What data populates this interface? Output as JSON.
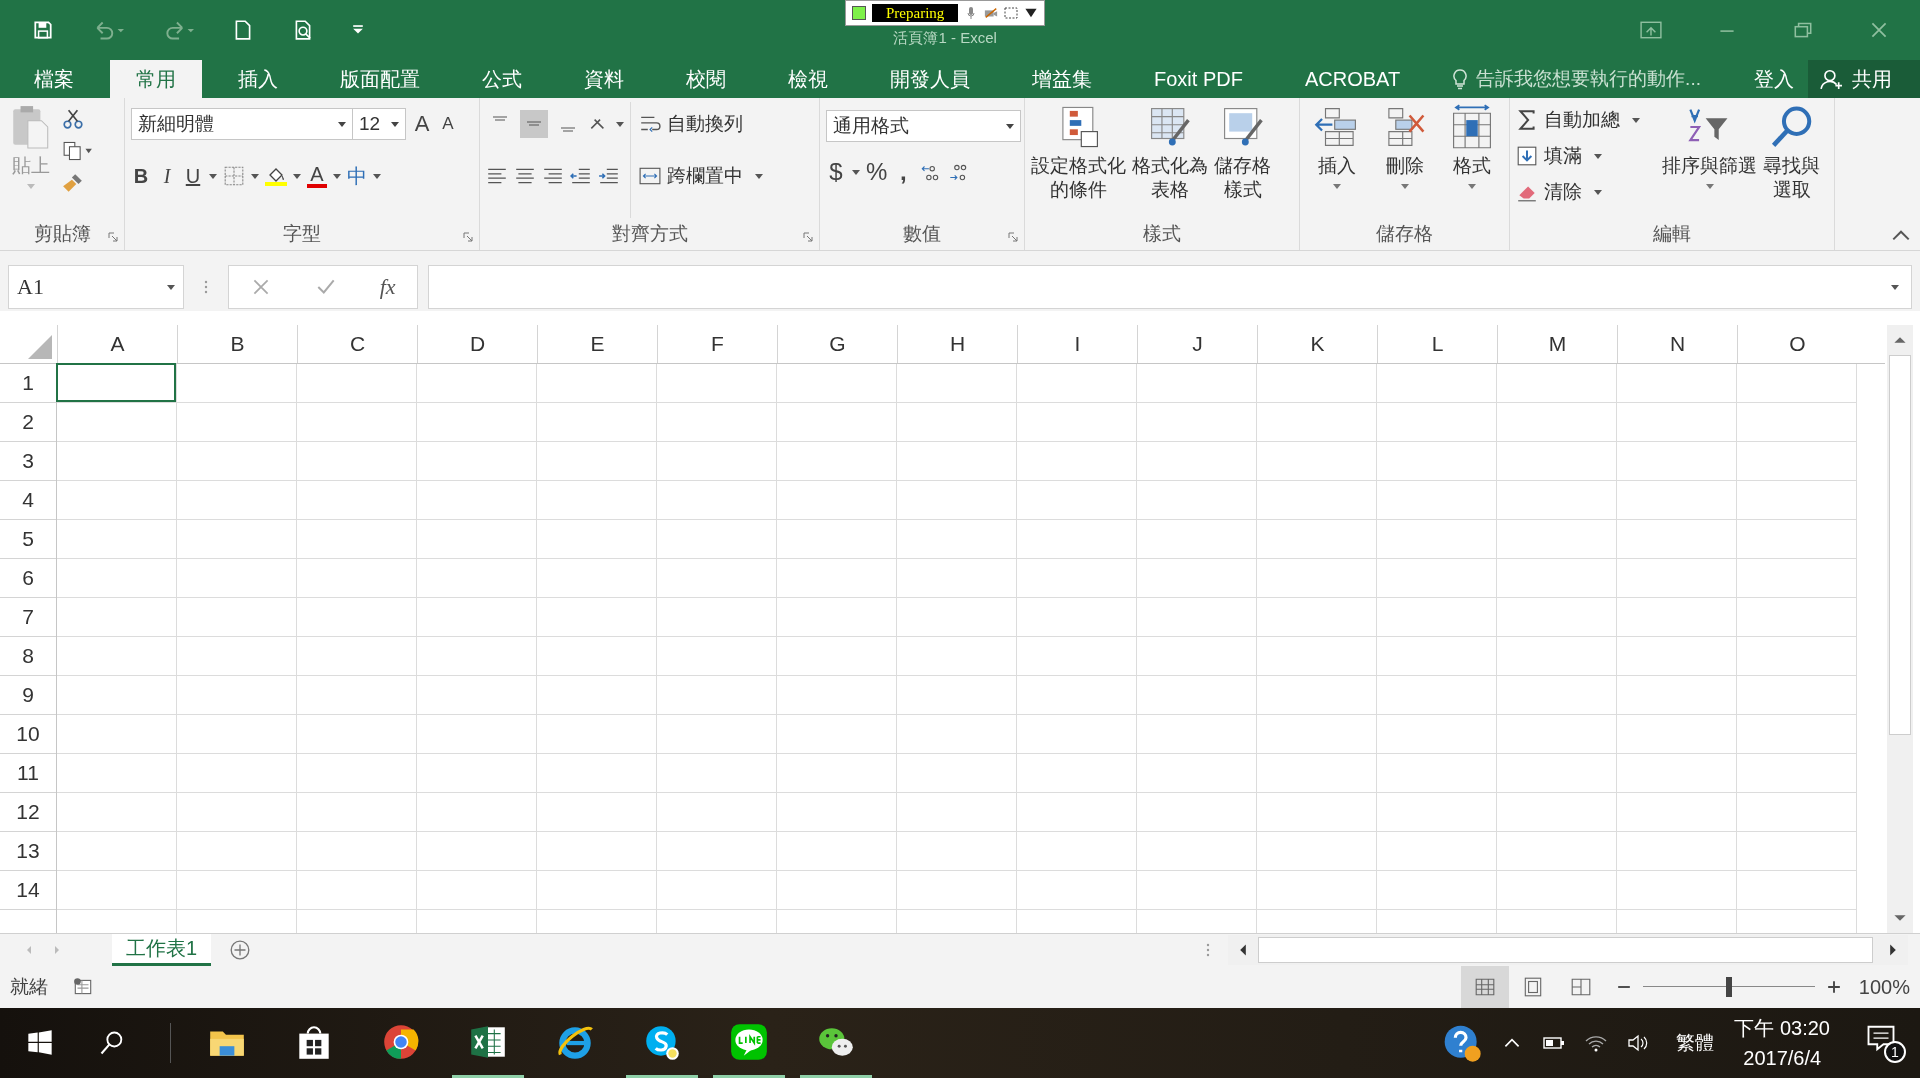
{
  "window": {
    "title": "活頁簿1 - Excel",
    "recorder": "Preparing"
  },
  "tabs": [
    {
      "label": "檔案",
      "selected": false
    },
    {
      "label": "常用",
      "selected": true
    },
    {
      "label": "插入",
      "selected": false
    },
    {
      "label": "版面配置",
      "selected": false
    },
    {
      "label": "公式",
      "selected": false
    },
    {
      "label": "資料",
      "selected": false
    },
    {
      "label": "校閱",
      "selected": false
    },
    {
      "label": "檢視",
      "selected": false
    },
    {
      "label": "開發人員",
      "selected": false
    },
    {
      "label": "增益集",
      "selected": false
    },
    {
      "label": "Foxit PDF",
      "selected": false
    },
    {
      "label": "ACROBAT",
      "selected": false
    }
  ],
  "tell_me": {
    "placeholder": "告訴我您想要執行的動作..."
  },
  "sign_in": "登入",
  "share": "共用",
  "clipboard": {
    "paste": "貼上",
    "label": "剪貼簿"
  },
  "font": {
    "name": "新細明體",
    "size": "12",
    "grow": "A",
    "shrink": "A",
    "bold": "B",
    "italic": "I",
    "underline": "U",
    "font_color": "A",
    "phonetic": "中",
    "label": "字型"
  },
  "alignment": {
    "vertical": [
      {
        "selected": false
      },
      {
        "selected": true
      },
      {
        "selected": false
      }
    ],
    "wrap": "自動換列",
    "merge": "跨欄置中",
    "label": "對齊方式"
  },
  "number": {
    "format": "通用格式",
    "currency": "$",
    "percent": "%",
    "comma": ",",
    "label": "數值"
  },
  "styles": {
    "buttons": [
      {
        "lines": [
          "設定格式化",
          "的條件"
        ],
        "kind": "conditional"
      },
      {
        "lines": [
          "格式化為",
          "表格"
        ],
        "kind": "table"
      },
      {
        "lines": [
          "儲存格",
          "樣式"
        ],
        "kind": "cellstyle"
      }
    ],
    "label": "樣式"
  },
  "cells": {
    "buttons": [
      {
        "label": "插入",
        "kind": "insert"
      },
      {
        "label": "刪除",
        "kind": "delete"
      },
      {
        "label": "格式",
        "kind": "format"
      }
    ],
    "label": "儲存格"
  },
  "editing": {
    "autosum": "自動加總",
    "fill": "填滿",
    "clear": "清除",
    "sort": "排序與篩選",
    "find": [
      "尋找與",
      "選取"
    ],
    "label": "編輯"
  },
  "formula_bar": {
    "name_box": "A1",
    "fx": "fx"
  },
  "columns": [
    "A",
    "B",
    "C",
    "D",
    "E",
    "F",
    "G",
    "H",
    "I",
    "J",
    "K",
    "L",
    "M",
    "N",
    "O"
  ],
  "rows": [
    "1",
    "2",
    "3",
    "4",
    "5",
    "6",
    "7",
    "8",
    "9",
    "10",
    "11",
    "12",
    "13",
    "14"
  ],
  "sheets": [
    {
      "label": "工作表1",
      "selected": true
    }
  ],
  "status": {
    "text": "就緒",
    "zoom": "100%",
    "zoom_slider": {
      "level": 0.5
    }
  },
  "taskbar": {
    "apps": [
      {
        "kind": "explorer",
        "running": false
      },
      {
        "kind": "store",
        "running": false
      },
      {
        "kind": "chrome",
        "running": false
      },
      {
        "kind": "excel",
        "running": true
      },
      {
        "kind": "ie",
        "running": false
      },
      {
        "kind": "skype",
        "running": true
      },
      {
        "kind": "line",
        "running": true
      },
      {
        "kind": "wechat",
        "running": true
      }
    ],
    "input": "繁體",
    "time": "下午 03:20",
    "date": "2017/6/4",
    "notifications": "1"
  }
}
